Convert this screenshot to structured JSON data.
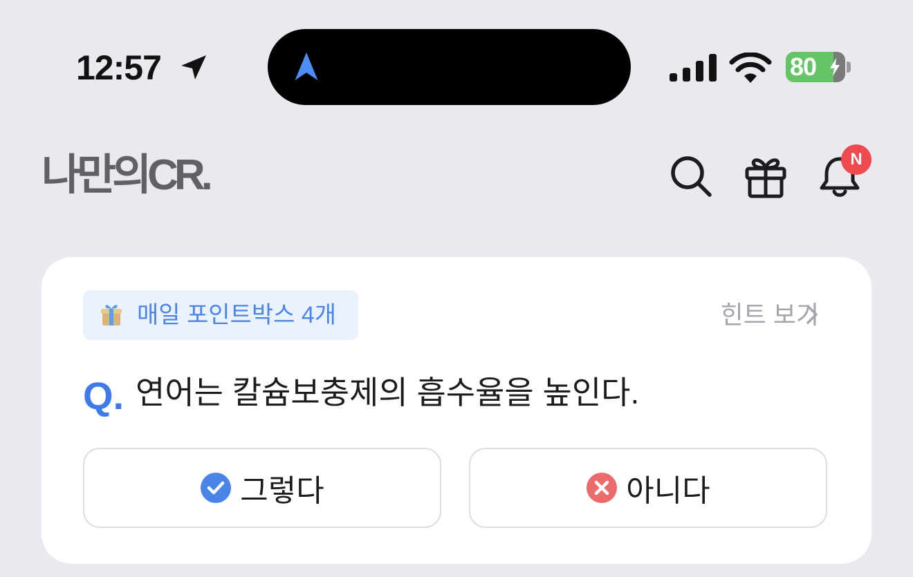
{
  "status_bar": {
    "time": "12:57",
    "battery_level": "80",
    "battery_fraction": 0.8,
    "icons": [
      "location-arrow-icon",
      "navigation-icon",
      "cellular-signal-icon",
      "wifi-icon",
      "battery-icon"
    ]
  },
  "header": {
    "logo": "나만의CR.",
    "notification_badge": "N",
    "icons": [
      "search-icon",
      "gift-icon",
      "bell-icon"
    ]
  },
  "quiz_card": {
    "points_label": "매일 포인트박스 4개",
    "hint_label": "힌트 보기",
    "q_prefix": "Q.",
    "question": "연어는 칼슘보충제의 흡수율을 높인다.",
    "answers": [
      {
        "label": "그렇다",
        "icon": "check-circle-icon"
      },
      {
        "label": "아니다",
        "icon": "x-circle-icon"
      }
    ]
  },
  "colors": {
    "background": "#e9e9ef",
    "accent_blue": "#3f7ae8",
    "badge_red": "#ef4a4f",
    "battery_green": "#65c466",
    "no_red": "#eb6b6b"
  }
}
